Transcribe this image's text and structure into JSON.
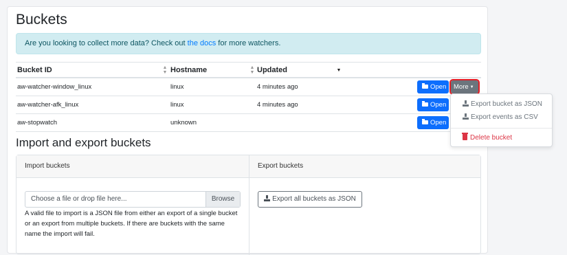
{
  "page": {
    "title": "Buckets"
  },
  "alert": {
    "prefix": "Are you looking to collect more data? Check out ",
    "link": "the docs",
    "suffix": " for more watchers."
  },
  "table": {
    "headers": {
      "bucket_id": "Bucket ID",
      "hostname": "Hostname",
      "updated": "Updated"
    },
    "rows": [
      {
        "id": "aw-watcher-window_linux",
        "hostname": "linux",
        "updated": "4 minutes ago"
      },
      {
        "id": "aw-watcher-afk_linux",
        "hostname": "linux",
        "updated": "4 minutes ago"
      },
      {
        "id": "aw-stopwatch",
        "hostname": "unknown",
        "updated": ""
      }
    ],
    "open_label": "Open",
    "more_label": "More"
  },
  "dropdown": {
    "export_json": "Export bucket as JSON",
    "export_csv": "Export events as CSV",
    "delete": "Delete bucket"
  },
  "io": {
    "title": "Import and export buckets",
    "import_header": "Import buckets",
    "export_header": "Export buckets",
    "file_placeholder": "Choose a file or drop file here...",
    "browse": "Browse",
    "help": "A valid file to import is a JSON file from either an export of a single bucket or an export from multiple buckets. If there are buckets with the same name the import will fail.",
    "export_all": "Export all buckets as JSON"
  },
  "colors": {
    "primary": "#0d6efd",
    "secondary": "#6c757d",
    "danger": "#dc3545",
    "alert_bg": "#d1ecf1"
  }
}
